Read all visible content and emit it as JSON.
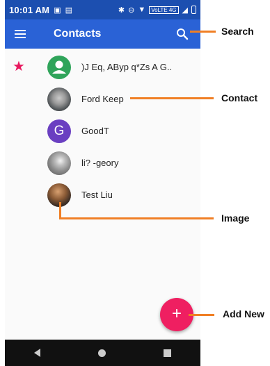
{
  "status_bar": {
    "time": "10:01 AM",
    "network_label": "VoLTE 4G"
  },
  "app_bar": {
    "title": "Contacts",
    "menu_icon": "menu-icon",
    "search_icon": "search-icon",
    "color": "#2a62d6"
  },
  "contacts": [
    {
      "name": ")J Eq, AByp q*Zs A G..",
      "avatar": "person-icon",
      "starred": true
    },
    {
      "name": "Ford Keep",
      "avatar": "photo"
    },
    {
      "name": "GoodT",
      "avatar": "G"
    },
    {
      "name": "li?  -geory",
      "avatar": "photo"
    },
    {
      "name": "Test Liu",
      "avatar": "photo"
    }
  ],
  "fab": {
    "label": "+",
    "color": "#ef1f61"
  },
  "nav_bar": {
    "icons": [
      "back-icon",
      "home-icon",
      "recents-icon"
    ]
  },
  "annotations": {
    "search": "Search",
    "contact": "Contact",
    "image": "Image",
    "add_new": "Add New",
    "color": "#f07f25"
  }
}
